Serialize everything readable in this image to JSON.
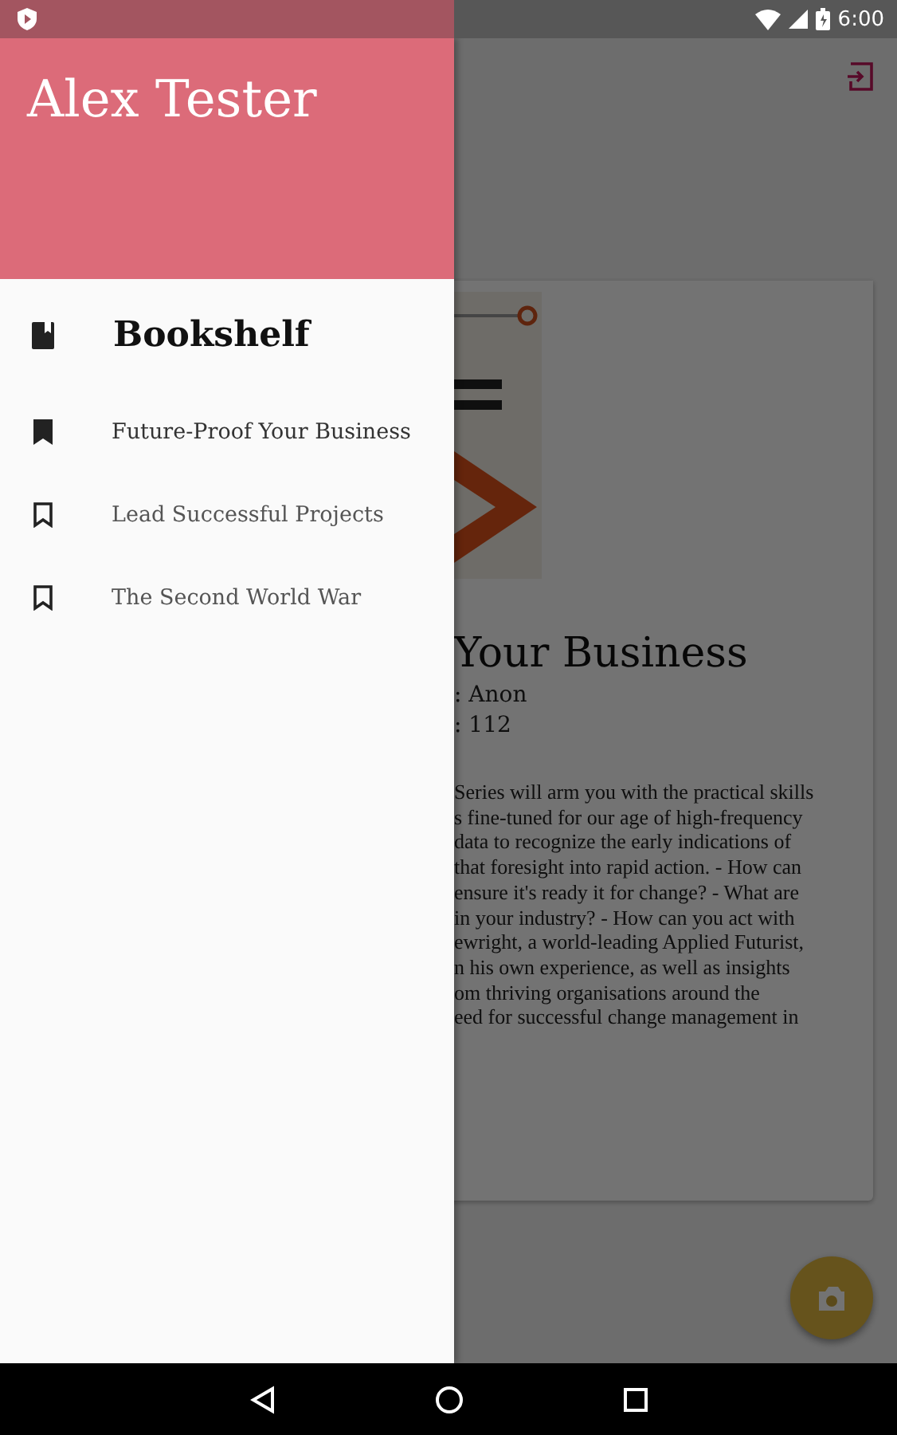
{
  "status_bar": {
    "time": "6:00"
  },
  "drawer": {
    "user_name": "Alex Tester",
    "section": {
      "label": "Bookshelf"
    },
    "books": [
      {
        "title": "Future-Proof Your Business",
        "selected": true
      },
      {
        "title": "Lead Successful Projects",
        "selected": false
      },
      {
        "title": "The Second World War",
        "selected": false
      }
    ]
  },
  "book_detail": {
    "title": "Your Business",
    "meta": [
      ": Anon",
      ": 112"
    ],
    "description_lines": [
      "Series will arm you with the practical skills",
      "s fine-tuned for our age of high-frequency",
      "data to recognize the early indications of",
      "that foresight into rapid action. - How can",
      "ensure it's ready it for change? - What are",
      "in your industry? - How can you act with",
      "ewright, a world-leading Applied Futurist,",
      "n his own experience, as well as insights",
      "om thriving organisations around the",
      "eed for successful change management in"
    ]
  }
}
